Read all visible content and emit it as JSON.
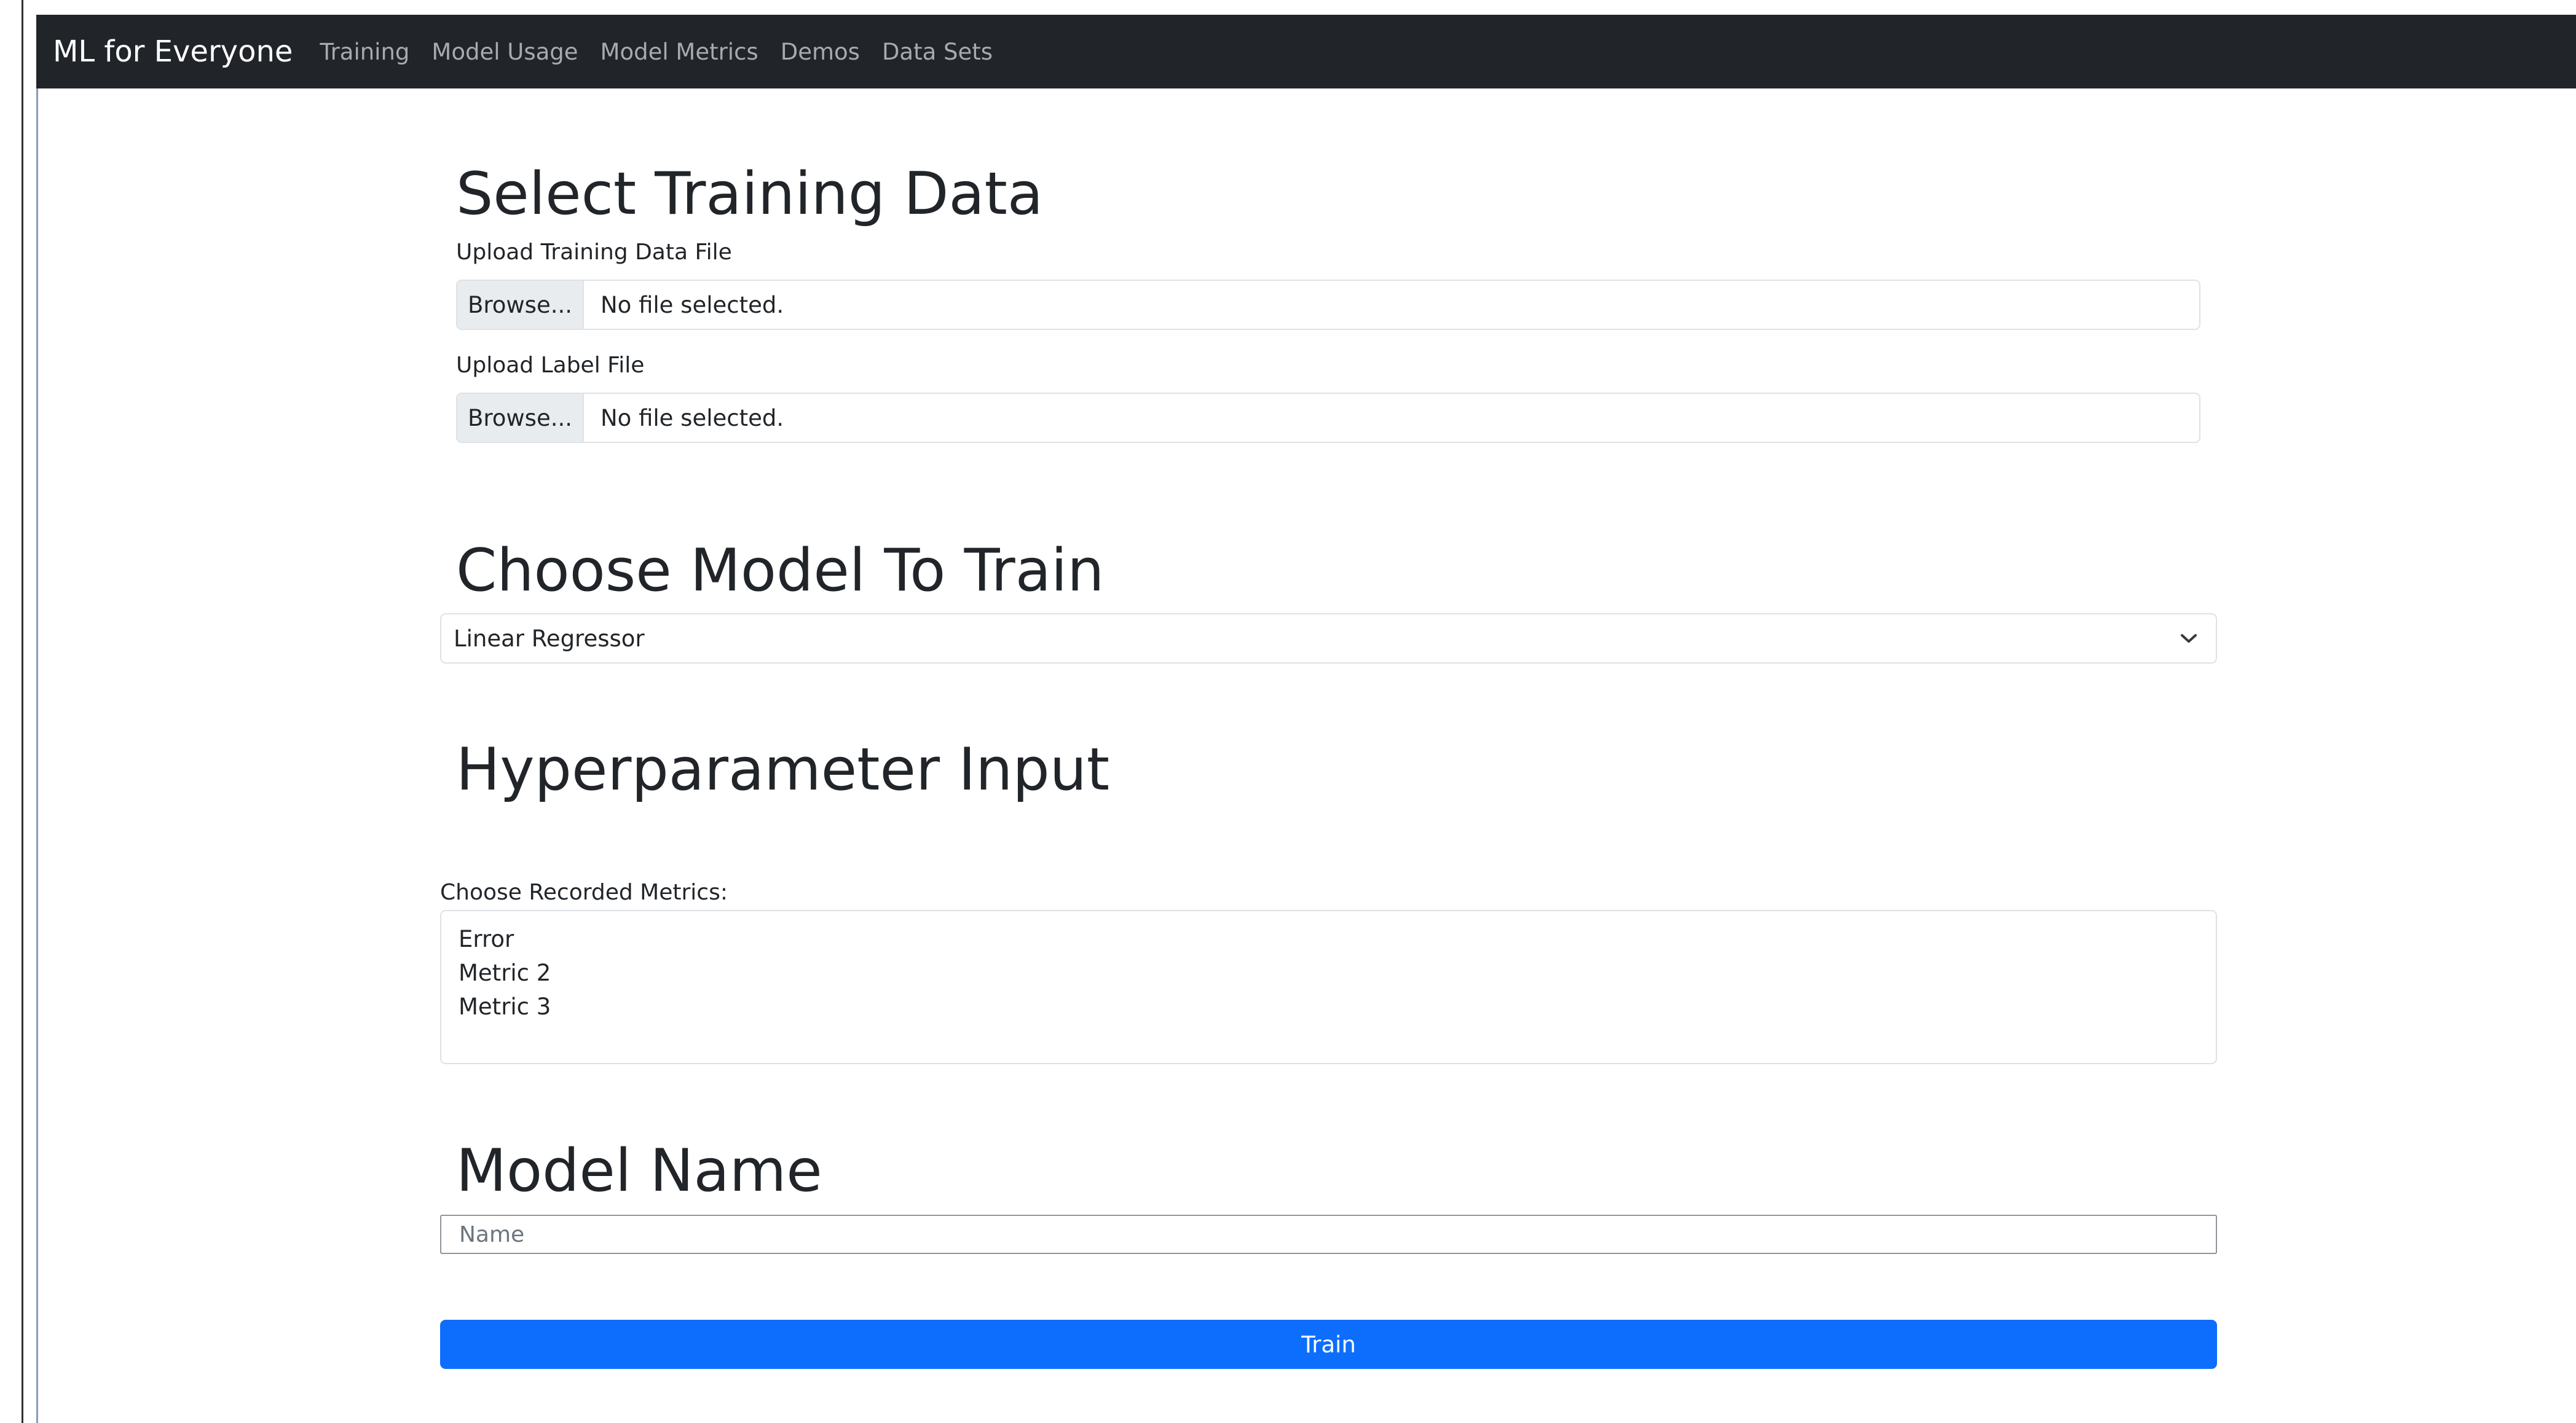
{
  "navbar": {
    "brand": "ML for Everyone",
    "links": [
      "Training",
      "Model Usage",
      "Model Metrics",
      "Demos",
      "Data Sets"
    ]
  },
  "training_data": {
    "heading": "Select Training Data",
    "data_file": {
      "label": "Upload Training Data File",
      "button": "Browse...",
      "status": "No file selected."
    },
    "label_file": {
      "label": "Upload Label File",
      "button": "Browse...",
      "status": "No file selected."
    }
  },
  "model": {
    "heading": "Choose Model To Train",
    "selected": "Linear Regressor"
  },
  "hyperparameters": {
    "heading": "Hyperparameter Input"
  },
  "metrics": {
    "label": "Choose Recorded Metrics:",
    "options": [
      "Error",
      "Metric 2",
      "Metric 3"
    ]
  },
  "model_name": {
    "heading": "Model Name",
    "placeholder": "Name",
    "value": ""
  },
  "train_button": "Train",
  "icons": {
    "select_chevron": "chevron-down-icon"
  },
  "colors": {
    "navbar": "#212529",
    "primary": "#0d6efd",
    "nav_link": "#a7abaf"
  }
}
